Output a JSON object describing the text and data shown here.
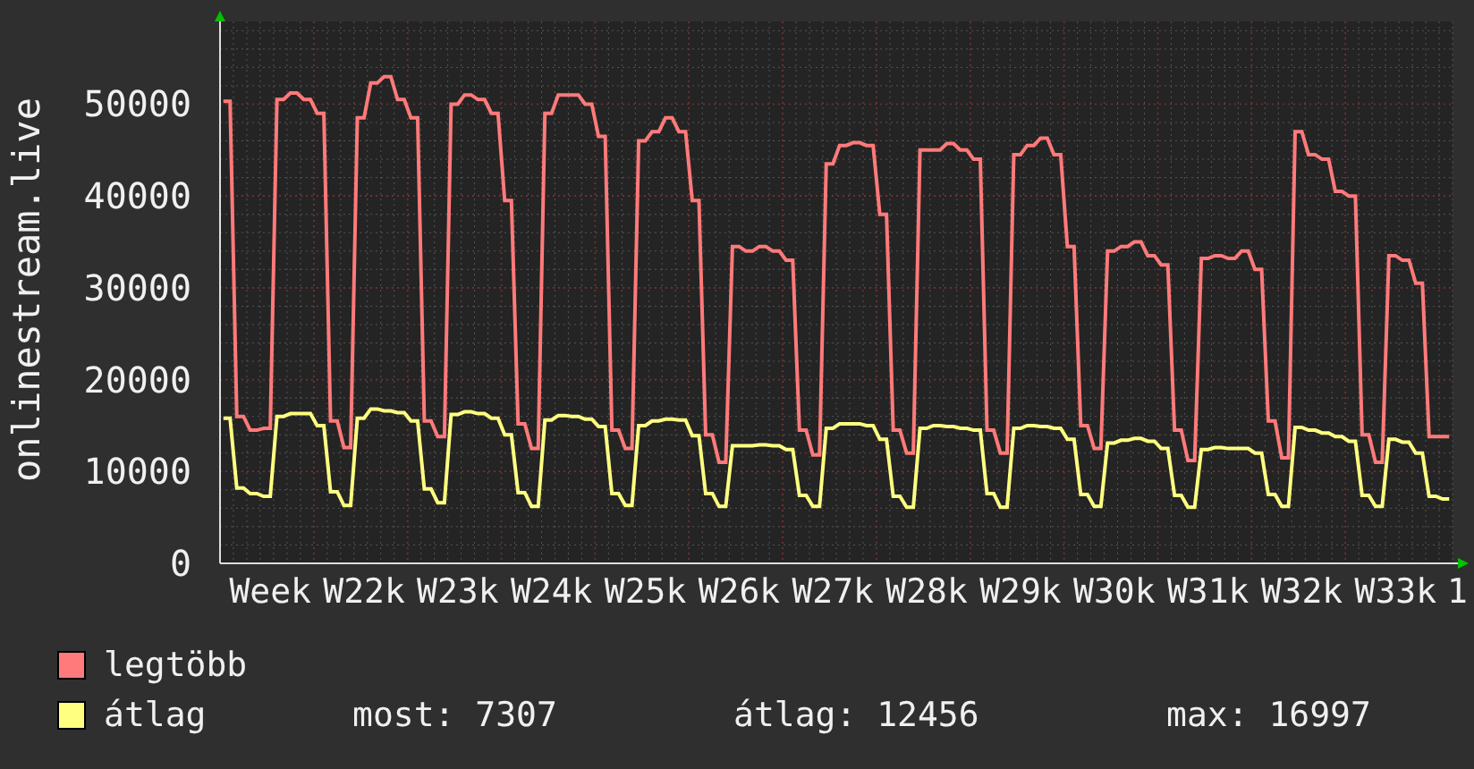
{
  "chart": {
    "edge_label": "1",
    "chart_data": {
      "type": "line",
      "ylabel": "onlinestream.live",
      "grid": true,
      "ylim": [
        0,
        59000
      ],
      "yticks": [
        0,
        10000,
        20000,
        30000,
        40000,
        50000
      ],
      "categories": [
        null,
        null,
        null,
        null,
        null,
        null,
        null,
        "Week",
        null,
        null,
        null,
        null,
        null,
        null,
        null,
        null,
        null,
        null,
        null,
        null,
        null,
        "W22k",
        null,
        null,
        null,
        null,
        null,
        null,
        null,
        null,
        null,
        null,
        null,
        null,
        null,
        "W23k",
        null,
        null,
        null,
        null,
        null,
        null,
        null,
        null,
        null,
        null,
        null,
        null,
        null,
        "W24k",
        null,
        null,
        null,
        null,
        null,
        null,
        null,
        null,
        null,
        null,
        null,
        null,
        null,
        "W25k",
        null,
        null,
        null,
        null,
        null,
        null,
        null,
        null,
        null,
        null,
        null,
        null,
        null,
        "W26k",
        null,
        null,
        null,
        null,
        null,
        null,
        null,
        null,
        null,
        null,
        null,
        null,
        null,
        "W27k",
        null,
        null,
        null,
        null,
        null,
        null,
        null,
        null,
        null,
        null,
        null,
        null,
        null,
        "W28k",
        null,
        null,
        null,
        null,
        null,
        null,
        null,
        null,
        null,
        null,
        null,
        null,
        null,
        "W29k",
        null,
        null,
        null,
        null,
        null,
        null,
        null,
        null,
        null,
        null,
        null,
        null,
        null,
        "W30k",
        null,
        null,
        null,
        null,
        null,
        null,
        null,
        null,
        null,
        null,
        null,
        null,
        null,
        "W31k",
        null,
        null,
        null,
        null,
        null,
        null,
        null,
        null,
        null,
        null,
        null,
        null,
        null,
        "W32k",
        null,
        null,
        null,
        null,
        null,
        null,
        null,
        null,
        null,
        null,
        null,
        null,
        null,
        "W33k",
        null,
        null,
        null,
        null,
        null,
        null,
        null,
        null
      ],
      "series": [
        {
          "name": "legtöbb",
          "color": "#ff7a7a",
          "values": [
            50300,
            50300,
            16000,
            16000,
            14500,
            14500,
            14700,
            14700,
            50500,
            50500,
            51200,
            51200,
            50500,
            50500,
            49000,
            49000,
            15500,
            15500,
            12600,
            12600,
            48500,
            48500,
            52300,
            52300,
            53000,
            53000,
            50500,
            50500,
            48500,
            48500,
            15500,
            15500,
            13800,
            13800,
            50000,
            50000,
            51000,
            51000,
            50500,
            50500,
            49000,
            49000,
            39500,
            39500,
            15200,
            15200,
            12500,
            12500,
            49000,
            49000,
            51000,
            51000,
            51000,
            51000,
            50000,
            50000,
            46500,
            46500,
            14500,
            14500,
            12500,
            12500,
            46000,
            46000,
            47000,
            47000,
            48500,
            48500,
            47000,
            47000,
            39500,
            39500,
            14000,
            14000,
            11000,
            11000,
            34500,
            34500,
            34000,
            34000,
            34500,
            34500,
            34000,
            34000,
            33000,
            33000,
            14500,
            14500,
            11800,
            11800,
            43500,
            43500,
            45500,
            45500,
            45800,
            45800,
            45500,
            45500,
            38000,
            38000,
            14500,
            14500,
            12000,
            12000,
            45000,
            45000,
            45000,
            45000,
            45700,
            45700,
            45000,
            45000,
            44000,
            44000,
            14500,
            14500,
            12000,
            12000,
            44500,
            44500,
            45500,
            45500,
            46300,
            46300,
            44500,
            44500,
            34500,
            34500,
            15000,
            15000,
            12500,
            12500,
            34000,
            34000,
            34500,
            34500,
            35000,
            35000,
            33500,
            33500,
            32500,
            32500,
            14500,
            14500,
            11200,
            11200,
            33200,
            33200,
            33500,
            33500,
            33200,
            33200,
            34000,
            34000,
            32000,
            32000,
            15500,
            15500,
            11500,
            11500,
            47000,
            47000,
            44500,
            44500,
            44000,
            44000,
            40500,
            40500,
            40000,
            40000,
            14000,
            14000,
            11000,
            11000,
            33500,
            33500,
            33000,
            33000,
            30500,
            30500,
            13800,
            13800,
            13800,
            13800
          ]
        },
        {
          "name": "átlag",
          "color": "#ffff80",
          "values": [
            15800,
            15800,
            8200,
            8200,
            7600,
            7600,
            7300,
            7300,
            16000,
            16000,
            16300,
            16300,
            16300,
            16300,
            15000,
            15000,
            7800,
            7800,
            6300,
            6300,
            15800,
            15800,
            16800,
            16800,
            16600,
            16600,
            16400,
            16400,
            15500,
            15500,
            8100,
            8100,
            6600,
            6600,
            16200,
            16200,
            16500,
            16500,
            16300,
            16300,
            15800,
            15800,
            14000,
            14000,
            7700,
            7700,
            6200,
            6200,
            15600,
            15600,
            16100,
            16100,
            16000,
            16000,
            15700,
            15700,
            14900,
            14900,
            7600,
            7600,
            6300,
            6300,
            15000,
            15000,
            15500,
            15500,
            15700,
            15700,
            15600,
            15600,
            13900,
            13900,
            7600,
            7600,
            6200,
            6200,
            12800,
            12800,
            12800,
            12800,
            12900,
            12900,
            12800,
            12800,
            12400,
            12400,
            7400,
            7400,
            6200,
            6200,
            14700,
            14700,
            15200,
            15200,
            15200,
            15200,
            15000,
            15000,
            13500,
            13500,
            7300,
            7300,
            6100,
            6100,
            14700,
            14700,
            15000,
            15000,
            14900,
            14900,
            14700,
            14700,
            14500,
            14500,
            7600,
            7600,
            6100,
            6100,
            14700,
            14700,
            15000,
            15000,
            14900,
            14900,
            14700,
            14700,
            13500,
            13500,
            7500,
            7500,
            6200,
            6200,
            13100,
            13100,
            13400,
            13400,
            13600,
            13600,
            13300,
            13300,
            12500,
            12500,
            7400,
            7400,
            6100,
            6100,
            12400,
            12400,
            12600,
            12600,
            12500,
            12500,
            12500,
            12500,
            12000,
            12000,
            7500,
            7500,
            6200,
            6200,
            14800,
            14800,
            14500,
            14500,
            14200,
            14200,
            13800,
            13800,
            13300,
            13300,
            7400,
            7400,
            6200,
            6200,
            13500,
            13500,
            13200,
            13200,
            12000,
            12000,
            7300,
            7300,
            7000,
            7000
          ]
        }
      ]
    }
  },
  "stats": [
    "most: 7307",
    "átlag: 12456",
    "max: 16997"
  ]
}
